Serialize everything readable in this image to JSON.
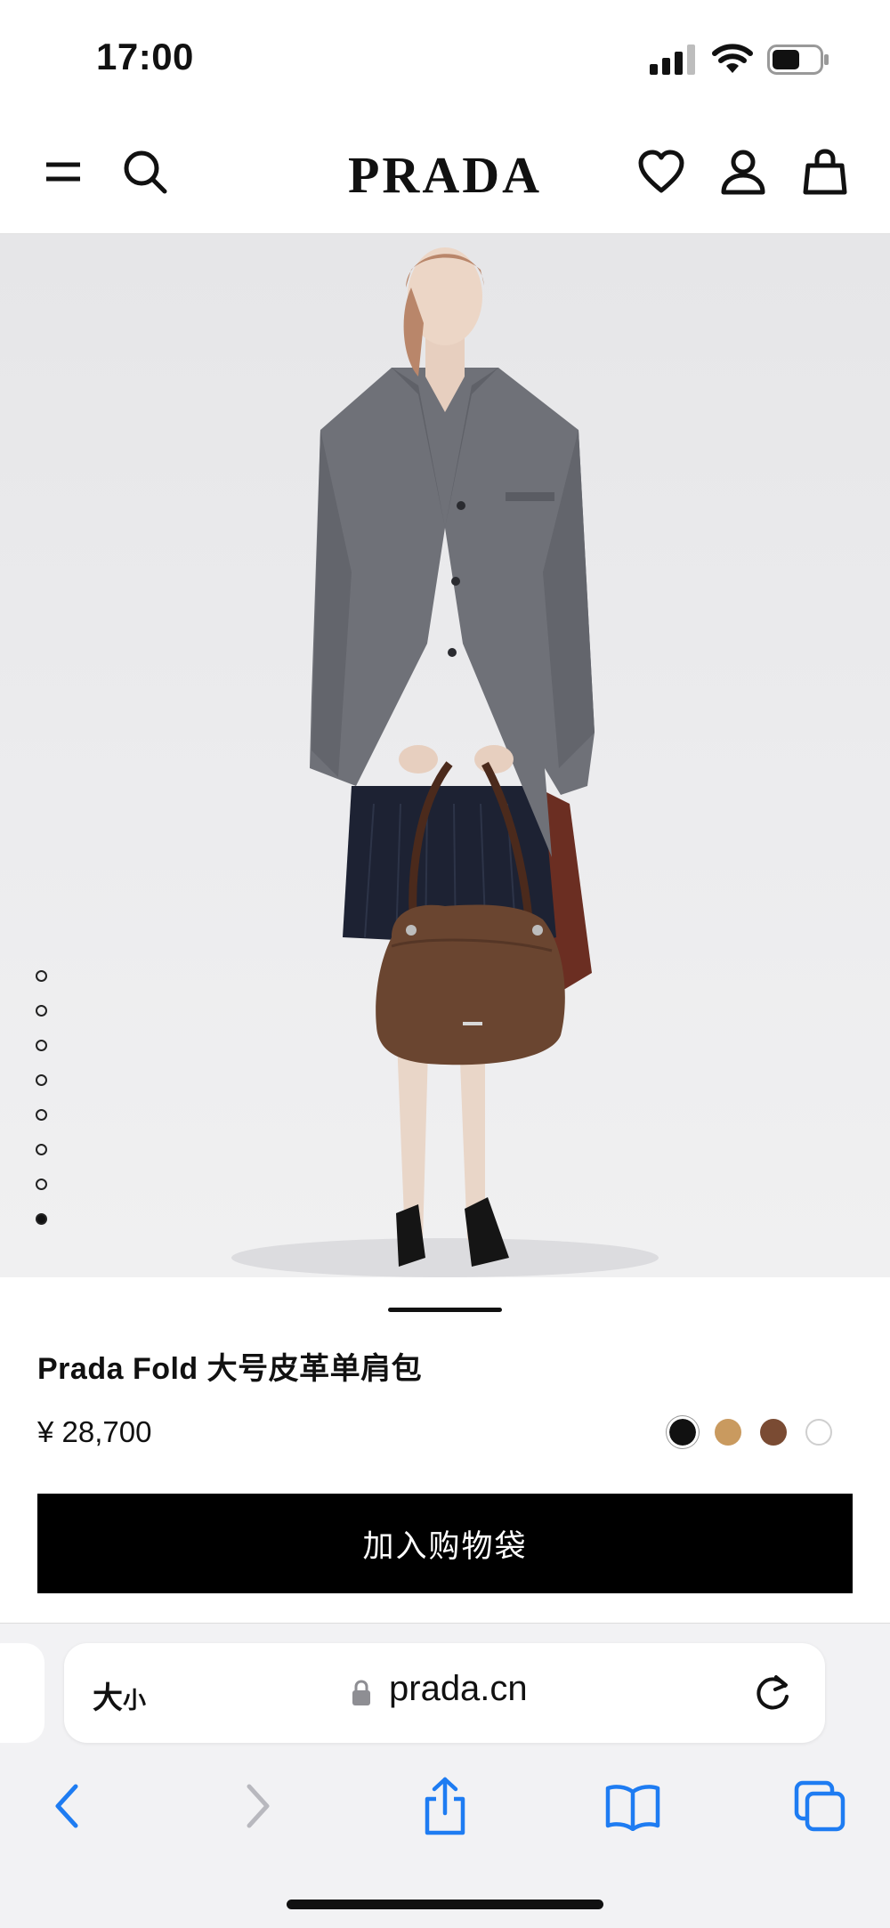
{
  "status_bar": {
    "time": "17:00"
  },
  "header": {
    "brand": "PRADA"
  },
  "gallery": {
    "total_images": 8,
    "active_index": 7
  },
  "product": {
    "name": "Prada Fold 大号皮革单肩包",
    "price": "¥ 28,700",
    "colors": [
      {
        "name": "black",
        "hex": "#111111"
      },
      {
        "name": "caramel",
        "hex": "#C99A5F"
      },
      {
        "name": "brown",
        "hex": "#7A4B33"
      },
      {
        "name": "white",
        "hex": "#FFFFFF"
      }
    ],
    "add_to_bag_label": "加入购物袋"
  },
  "browser": {
    "text_size_label_big": "大",
    "text_size_label_small": "小",
    "url": "prada.cn"
  },
  "colors": {
    "ios_blue": "#1E7CF2",
    "ios_gray": "#B8B8BE"
  }
}
